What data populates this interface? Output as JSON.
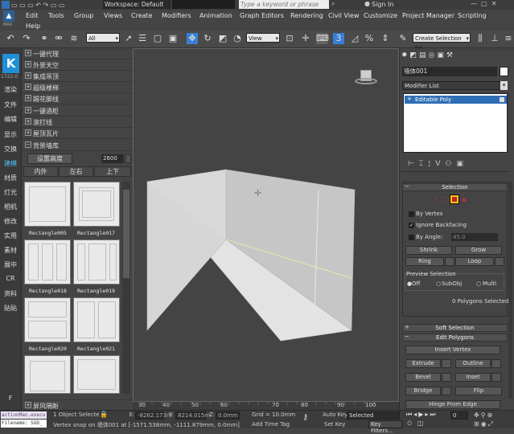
{
  "title_bar": {
    "workspace": "Workspace: Default",
    "search_placeholder": "Type a keyword or phrase",
    "sign_in": "Sign In"
  },
  "menu": [
    "Edit",
    "Tools",
    "Group",
    "Views",
    "Create",
    "Modifiers",
    "Animation",
    "Graph Editors",
    "Rendering",
    "Civil View",
    "Customize",
    "Project Manager",
    "Scripting",
    "Help"
  ],
  "toolbar": {
    "filter": "All",
    "ref_coord": "View",
    "named_sel": "Create Selection Se",
    "snap_value": "3"
  },
  "left_strip": {
    "logo": "K",
    "version": "1722.0",
    "items": [
      "渲染",
      "文件",
      "编辑",
      "显示",
      "交换",
      "建模",
      "材质",
      "灯光",
      "相机",
      "修改",
      "实用",
      "素材",
      "展中",
      "CR",
      "资料",
      "贴贴"
    ],
    "active_index": 5,
    "bottom": "F"
  },
  "plugin": {
    "rows": [
      "一键代理",
      "外景天空",
      "集成吊顶",
      "超级楼梯",
      "踢花脚线",
      "一键酒柜",
      "滚打线",
      "屋顶瓦片",
      "背景墙库"
    ],
    "height_label": "设置高度",
    "height_value": "2600",
    "tabs": [
      "内外",
      "左右",
      "上下"
    ],
    "thumbs": [
      "Rectangle005",
      "Rectangle017",
      "Rectangle018",
      "Rectangle019",
      "Rectangle020",
      "Rectangle021"
    ],
    "footer": "屏风隔断"
  },
  "right_panel": {
    "object_name": "墙体001",
    "modifier_list": "Modifier List",
    "stack_item": "Editable Poly",
    "selection_title": "Selection",
    "by_vertex": "By Vertex",
    "ignore_backfacing": "Ignore Backfacing",
    "by_angle": "By Angle:",
    "angle_value": "45.0",
    "shrink": "Shrink",
    "grow": "Grow",
    "ring": "Ring",
    "loop": "Loop",
    "preview_title": "Preview Selection",
    "preview_opts": [
      "Off",
      "SubObj",
      "Multi"
    ],
    "poly_status": "0 Polygons Selected",
    "soft_sel": "Soft Selection",
    "edit_polys": "Edit Polygons",
    "insert_vertex": "Insert Vertex",
    "extrude": "Extrude",
    "outline": "Outline",
    "bevel": "Bevel",
    "inset": "Inset",
    "bridge": "Bridge",
    "flip": "Flip",
    "hinge": "Hinge From Edge"
  },
  "timeline": {
    "ticks": [
      "30",
      "40",
      "50",
      "60",
      "70",
      "80",
      "90",
      "100"
    ]
  },
  "status": {
    "obj_selected": "1 Object Selecte",
    "message": "Vertex snap on 墙体001 at [-1571.538mm, -1111.879mm, 0.0mm]",
    "x_label": "X:",
    "x": "-8262.173m",
    "y_label": "Y:",
    "y": "8214.015m",
    "z_label": "Z:",
    "z": "0.0mm",
    "grid": "Grid = 10.0mm",
    "add_time_tag": "Add Time Tag",
    "auto_key": "Auto Key",
    "selected": "Selected",
    "set_key": "Set Key",
    "key_filters": "Key Filters...",
    "frame": "0",
    "script1": "actionMan.execu",
    "script2": "Filename: SGD_"
  }
}
